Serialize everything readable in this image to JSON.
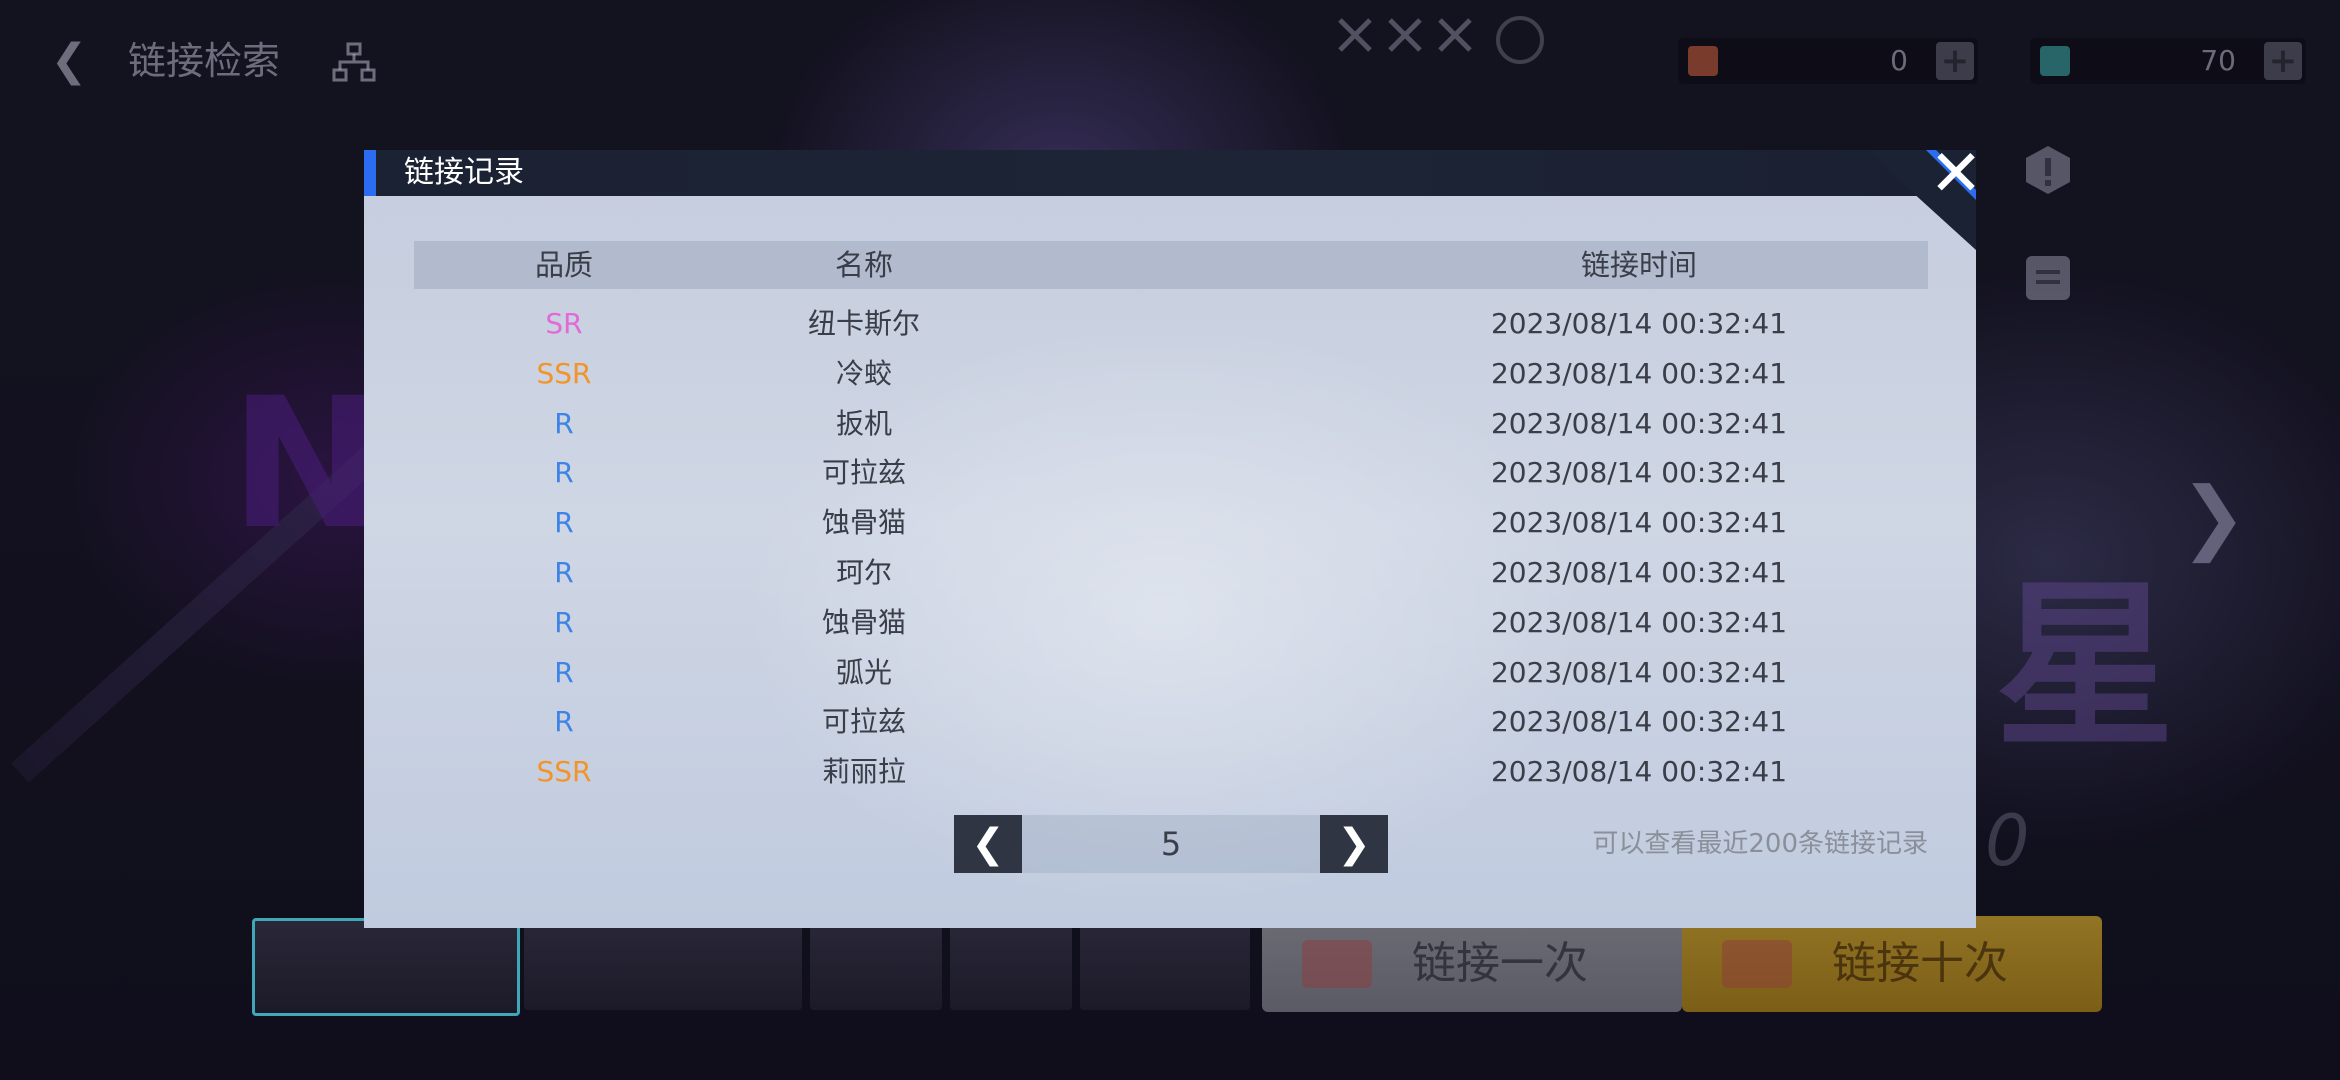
{
  "topbar": {
    "back_icon": "back-arrow-icon",
    "title": "链接检索",
    "tree_icon": "hierarchy-icon",
    "resources": [
      {
        "icon": "ticket-icon",
        "value": "0",
        "icon_color": "#c05a3a"
      },
      {
        "icon": "crystal-icon",
        "value": "70",
        "icon_color": "#3aa0a0"
      }
    ],
    "plus_label": "+"
  },
  "background": {
    "left_text": "NE",
    "right_text": "星",
    "right_num": "0"
  },
  "dialog": {
    "title": "链接记录",
    "close_icon": "close-icon",
    "columns": {
      "quality": "品质",
      "name": "名称",
      "time": "链接时间"
    },
    "rows": [
      {
        "quality": "SR",
        "name": "纽卡斯尔",
        "time": "2023/08/14 00:32:41"
      },
      {
        "quality": "SSR",
        "name": "冷蛟",
        "time": "2023/08/14 00:32:41"
      },
      {
        "quality": "R",
        "name": "扳机",
        "time": "2023/08/14 00:32:41"
      },
      {
        "quality": "R",
        "name": "可拉兹",
        "time": "2023/08/14 00:32:41"
      },
      {
        "quality": "R",
        "name": "蚀骨猫",
        "time": "2023/08/14 00:32:41"
      },
      {
        "quality": "R",
        "name": "珂尔",
        "time": "2023/08/14 00:32:41"
      },
      {
        "quality": "R",
        "name": "蚀骨猫",
        "time": "2023/08/14 00:32:41"
      },
      {
        "quality": "R",
        "name": "弧光",
        "time": "2023/08/14 00:32:41"
      },
      {
        "quality": "R",
        "name": "可拉兹",
        "time": "2023/08/14 00:32:41"
      },
      {
        "quality": "SSR",
        "name": "莉丽拉",
        "time": "2023/08/14 00:32:41"
      }
    ],
    "pager": {
      "prev_icon": "chevron-left-icon",
      "next_icon": "chevron-right-icon",
      "page": "5"
    },
    "note": "可以查看最近200条链接记录"
  },
  "bottom": {
    "pull_one": "链接一次",
    "pull_ten": "链接十次"
  },
  "colors": {
    "SR": "#e16ad7",
    "SSR": "#f2942a",
    "R": "#3e83e6",
    "accent": "#2c6cf0"
  }
}
